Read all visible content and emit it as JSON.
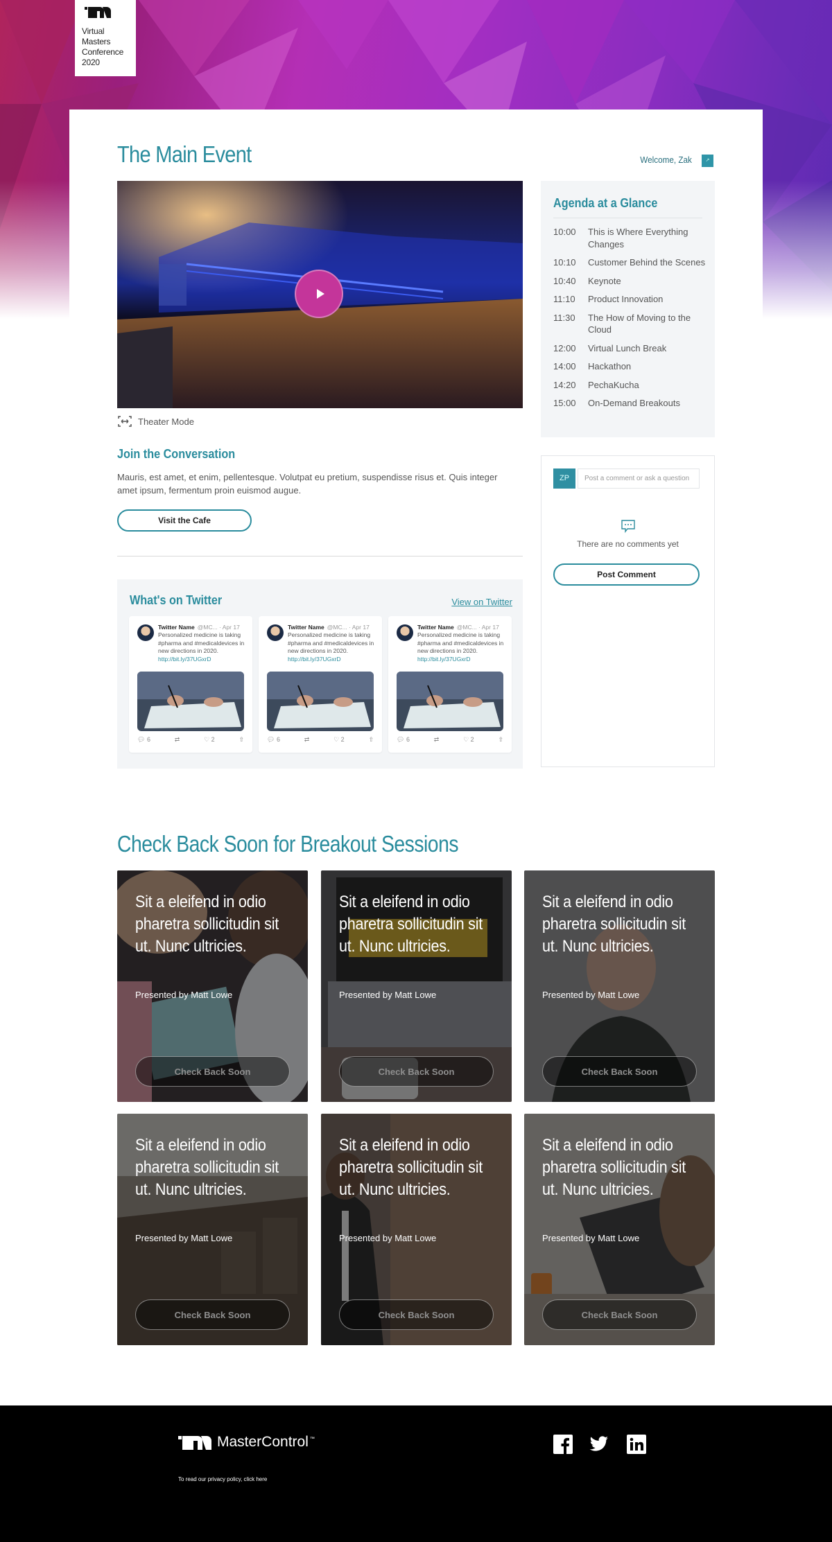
{
  "brand": {
    "badge_lines": [
      "Virtual",
      "Masters",
      "Conference",
      "2020"
    ],
    "logo_icon": "mastercontrol-m-icon"
  },
  "header": {
    "title": "The Main Event",
    "welcome": "Welcome, Zak",
    "user_button_icon": "external-link-icon"
  },
  "video": {
    "play_icon": "play-icon",
    "theater_label": "Theater Mode",
    "theater_icon": "expand-horizontal-icon"
  },
  "conversation": {
    "title": "Join the Conversation",
    "text": "Mauris, est amet, et enim, pellentesque. Volutpat eu pretium, suspendisse risus et. Quis integer amet ipsum, fermentum proin euismod augue.",
    "button": "Visit the Cafe"
  },
  "twitter": {
    "title": "What's on Twitter",
    "link": "View on Twitter",
    "tweets": [
      {
        "name": "Twitter Name",
        "handle": "@MC... · Apr 17",
        "text": "Personalized medicine is taking #pharma and #medicaldevices in new directions in 2020.",
        "link": "http://bit.ly/37UGxrD",
        "replies": "6",
        "likes": "2"
      },
      {
        "name": "Twitter Name",
        "handle": "@MC... · Apr 17",
        "text": "Personalized medicine is taking #pharma and #medicaldevices in new directions in 2020.",
        "link": "http://bit.ly/37UGxrD",
        "replies": "6",
        "likes": "2"
      },
      {
        "name": "Twitter Name",
        "handle": "@MC... · Apr 17",
        "text": "Personalized medicine is taking #pharma and #medicaldevices in new directions in 2020.",
        "link": "http://bit.ly/37UGxrD",
        "replies": "6",
        "likes": "2"
      }
    ]
  },
  "agenda": {
    "title": "Agenda at a Glance",
    "items": [
      {
        "time": "10:00",
        "title": "This is Where Everything Changes"
      },
      {
        "time": "10:10",
        "title": "Customer Behind the Scenes"
      },
      {
        "time": "10:40",
        "title": "Keynote"
      },
      {
        "time": "11:10",
        "title": "Product Innovation"
      },
      {
        "time": "11:30",
        "title": "The How of Moving to the Cloud"
      },
      {
        "time": "12:00",
        "title": "Virtual Lunch Break"
      },
      {
        "time": "14:00",
        "title": "Hackathon"
      },
      {
        "time": "14:20",
        "title": "PechaKucha"
      },
      {
        "time": "15:00",
        "title": "On-Demand Breakouts"
      }
    ]
  },
  "comments": {
    "avatar_initials": "ZP",
    "placeholder": "Post a comment or ask a question",
    "empty_text": "There are no comments yet",
    "button": "Post Comment"
  },
  "breakouts": {
    "title": "Check Back Soon for Breakout Sessions",
    "sessions": [
      {
        "title": "Sit a eleifend in odio pharetra sollicitudin sit ut. Nunc ultricies.",
        "presenter": "Presented by Matt Lowe",
        "button": "Check Back Soon"
      },
      {
        "title": "Sit a eleifend in odio pharetra sollicitudin sit ut. Nunc ultricies.",
        "presenter": "Presented by Matt Lowe",
        "button": "Check Back Soon"
      },
      {
        "title": "Sit a eleifend in odio pharetra sollicitudin sit ut. Nunc ultricies.",
        "presenter": "Presented by Matt Lowe",
        "button": "Check Back Soon"
      },
      {
        "title": "Sit a eleifend in odio pharetra sollicitudin sit ut. Nunc ultricies.",
        "presenter": "Presented by Matt Lowe",
        "button": "Check Back Soon"
      },
      {
        "title": "Sit a eleifend in odio pharetra sollicitudin sit ut. Nunc ultricies.",
        "presenter": "Presented by Matt Lowe",
        "button": "Check Back Soon"
      },
      {
        "title": "Sit a eleifend in odio pharetra sollicitudin sit ut. Nunc ultricies.",
        "presenter": "Presented by Matt Lowe",
        "button": "Check Back Soon"
      }
    ]
  },
  "footer": {
    "brand": "MasterControl",
    "trademark": "™",
    "privacy": "To read our privacy policy, click here",
    "social": [
      "facebook-icon",
      "twitter-icon",
      "linkedin-icon"
    ]
  },
  "colors": {
    "accent": "#2a8c9d",
    "play": "#c4359a",
    "footer_bg": "#000000"
  }
}
